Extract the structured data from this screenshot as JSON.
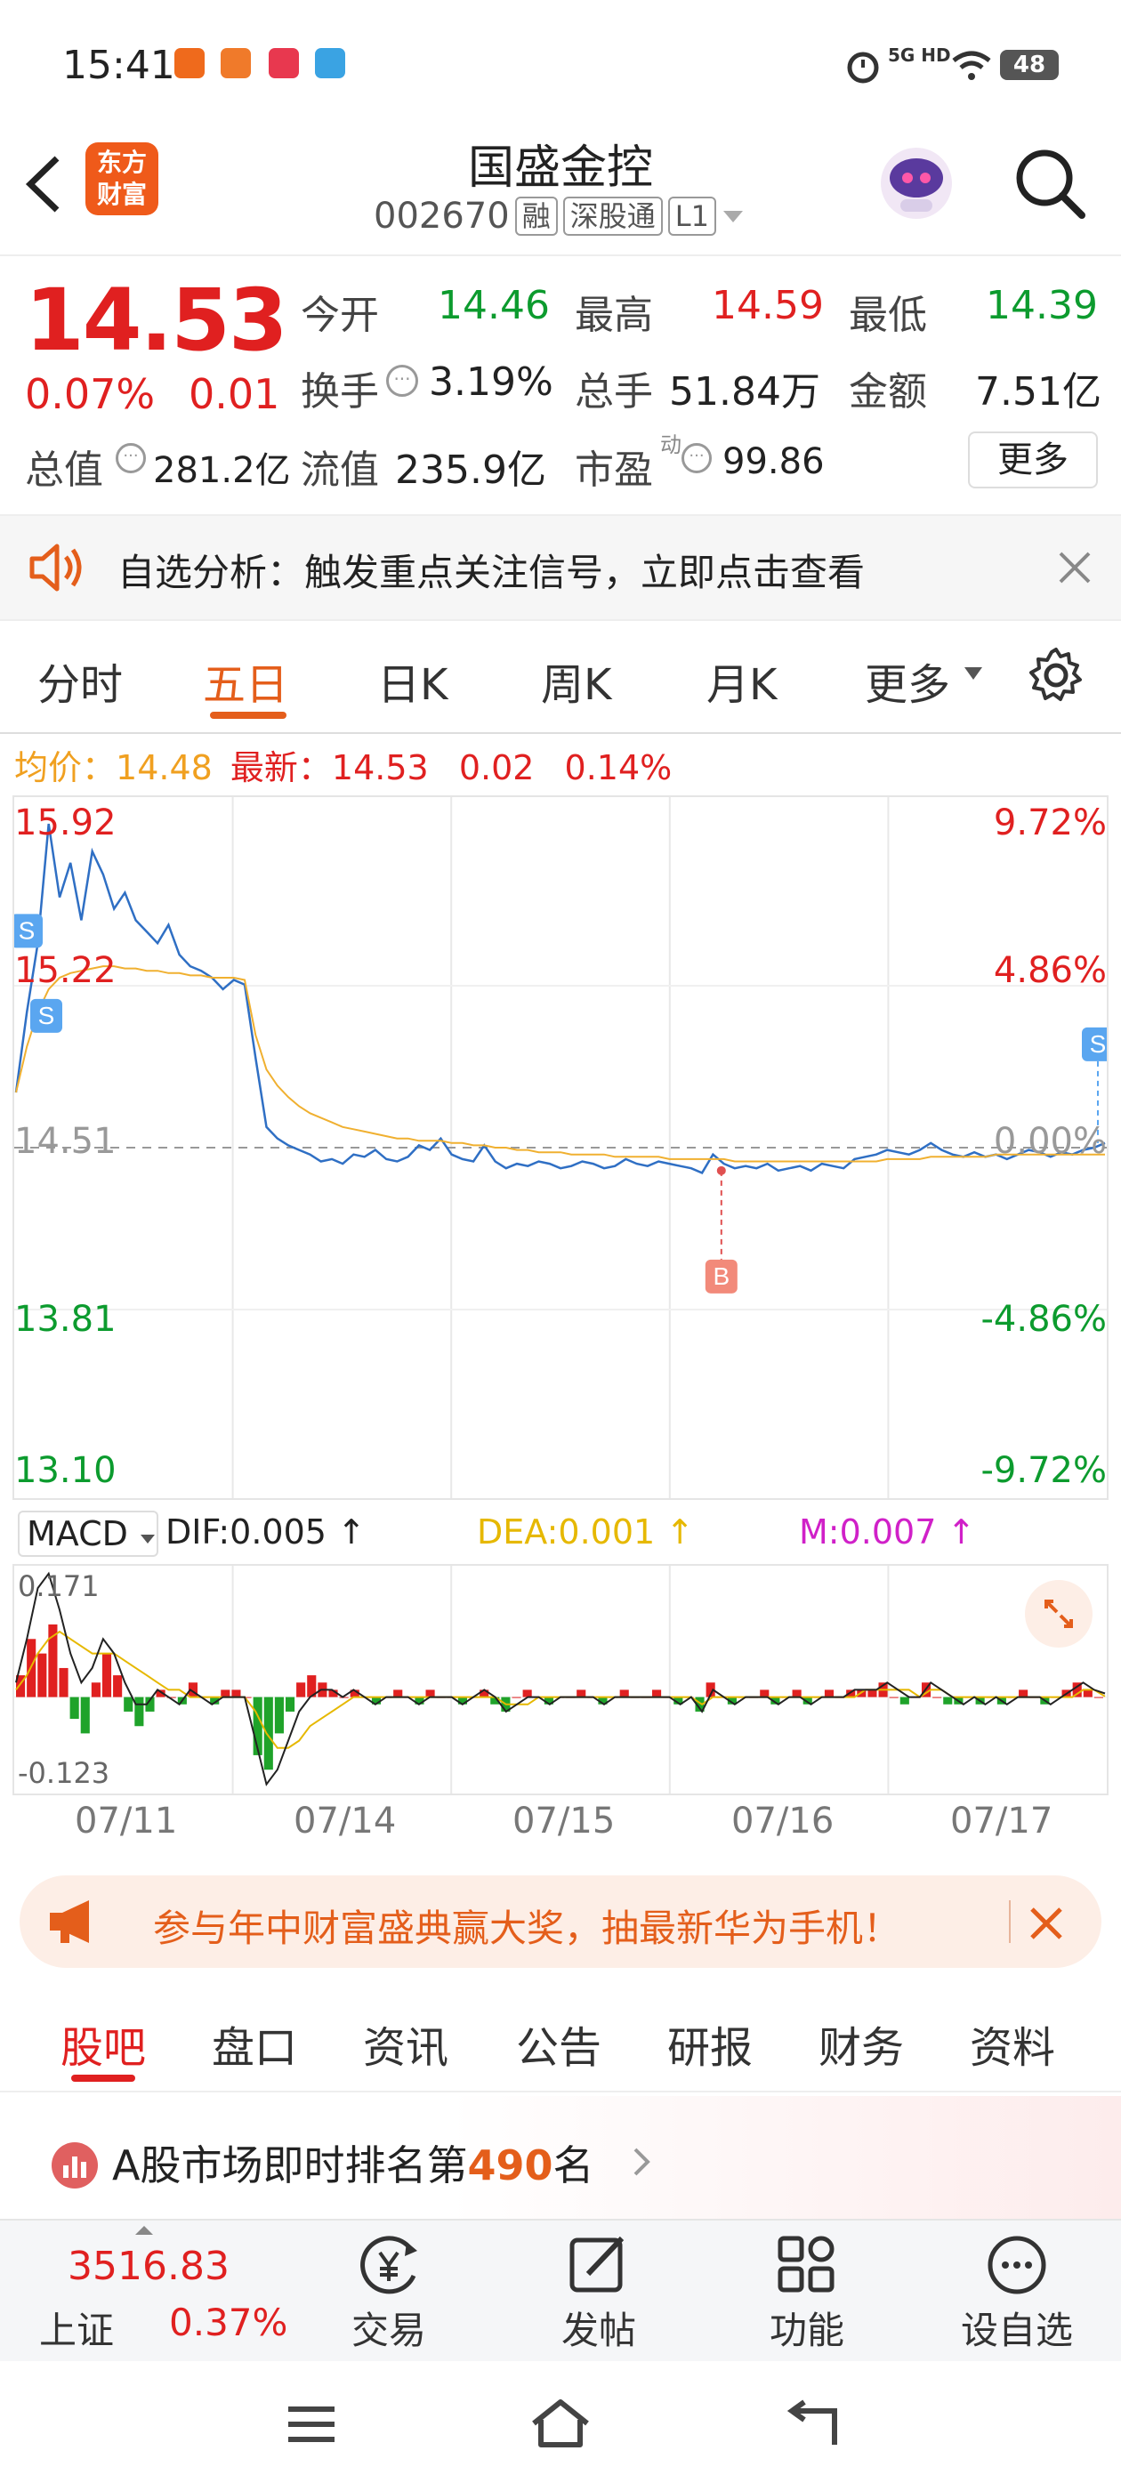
{
  "status_bar": {
    "time": "15:41",
    "network": "5G HD",
    "battery": "48"
  },
  "header": {
    "back_icon": "chevron-left-icon",
    "logo_line1": "东方",
    "logo_line2": "财富",
    "stock_name": "国盛金控",
    "stock_code": "002670",
    "tags": [
      "融",
      "深股通",
      "L1"
    ],
    "search_icon": "search-icon"
  },
  "quote": {
    "price": "14.53",
    "change_pct": "0.07%",
    "change_abs": "0.01",
    "open_label": "今开",
    "open": "14.46",
    "high_label": "最高",
    "high": "14.59",
    "low_label": "最低",
    "low": "14.39",
    "turnover_label": "换手",
    "turnover": "3.19%",
    "volume_label": "总手",
    "volume": "51.84万",
    "amount_label": "金额",
    "amount": "7.51亿",
    "mktcap_label": "总值",
    "mktcap": "281.2亿",
    "float_label": "流值",
    "float_cap": "235.9亿",
    "pe_label": "市盈",
    "pe_sup": "动",
    "pe": "99.86",
    "more_label": "更多"
  },
  "alert": {
    "text": "自选分析：触发重点关注信号，立即点击查看"
  },
  "chart_tabs": [
    "分时",
    "五日",
    "日K",
    "周K",
    "月K",
    "更多"
  ],
  "active_tab": "五日",
  "legend": {
    "avg_label": "均价：",
    "avg": "14.48",
    "latest_label": "最新：",
    "latest": "14.53",
    "change": "0.02",
    "change_pct": "0.14%"
  },
  "chart_data": {
    "type": "line",
    "title": "",
    "y_left_labels": [
      "15.92",
      "15.22",
      "14.51",
      "13.81",
      "13.10"
    ],
    "y_right_labels": [
      "9.72%",
      "4.86%",
      "0.00%",
      "-4.86%",
      "-9.72%"
    ],
    "ylim": [
      13.1,
      15.92
    ],
    "reference": 14.51,
    "x_labels": [
      "07/11",
      "07/14",
      "07/15",
      "07/16",
      "07/17"
    ],
    "markers": [
      {
        "label": "S",
        "day": "07/11",
        "price": 15.45
      },
      {
        "label": "S",
        "day": "07/11",
        "price": 15.08
      },
      {
        "label": "B",
        "day": "07/16",
        "price": 14.41
      },
      {
        "label": "S",
        "day": "07/17",
        "price": 14.53
      }
    ],
    "series": [
      {
        "values": [
          14.75,
          15.1,
          15.4,
          15.92,
          15.6,
          15.75,
          15.5,
          15.8,
          15.7,
          15.55,
          15.62,
          15.5,
          15.45,
          15.4,
          15.48,
          15.35,
          15.3,
          15.28,
          15.25,
          15.2,
          15.24,
          15.22,
          14.9,
          14.6,
          14.55,
          14.52,
          14.5,
          14.48,
          14.45,
          14.46,
          14.44,
          14.48,
          14.47,
          14.5,
          14.46,
          14.45,
          14.47,
          14.52,
          14.5,
          14.55,
          14.48,
          14.46,
          14.45,
          14.52,
          14.45,
          14.42,
          14.44,
          14.43,
          14.45,
          14.44,
          14.42,
          14.43,
          14.45,
          14.44,
          14.42,
          14.43,
          14.46,
          14.44,
          14.43,
          14.45,
          14.44,
          14.43,
          14.42,
          14.4,
          14.48,
          14.44,
          14.42,
          14.43,
          14.42,
          14.44,
          14.41,
          14.42,
          14.43,
          14.41,
          14.44,
          14.43,
          14.42,
          14.46,
          14.47,
          14.48,
          14.5,
          14.49,
          14.48,
          14.5,
          14.53,
          14.5,
          14.48,
          14.47,
          14.49,
          14.47,
          14.48,
          14.46,
          14.48,
          14.5,
          14.49,
          14.47,
          14.49,
          14.48,
          14.5,
          14.51,
          14.53
        ]
      },
      {
        "values": [
          14.75,
          14.95,
          15.1,
          15.2,
          15.25,
          15.27,
          15.28,
          15.29,
          15.3,
          15.3,
          15.29,
          15.29,
          15.28,
          15.28,
          15.27,
          15.27,
          15.26,
          15.26,
          15.25,
          15.25,
          15.25,
          15.24,
          15.0,
          14.85,
          14.78,
          14.73,
          14.69,
          14.66,
          14.64,
          14.62,
          14.6,
          14.59,
          14.58,
          14.57,
          14.56,
          14.55,
          14.55,
          14.54,
          14.54,
          14.54,
          14.53,
          14.53,
          14.52,
          14.52,
          14.51,
          14.51,
          14.5,
          14.5,
          14.49,
          14.49,
          14.49,
          14.48,
          14.48,
          14.48,
          14.48,
          14.47,
          14.47,
          14.47,
          14.47,
          14.47,
          14.46,
          14.46,
          14.46,
          14.46,
          14.46,
          14.46,
          14.45,
          14.45,
          14.45,
          14.45,
          14.45,
          14.45,
          14.45,
          14.45,
          14.45,
          14.45,
          14.45,
          14.45,
          14.45,
          14.45,
          14.46,
          14.46,
          14.46,
          14.46,
          14.47,
          14.47,
          14.47,
          14.47,
          14.47,
          14.47,
          14.48,
          14.48,
          14.48,
          14.48,
          14.48,
          14.48,
          14.48,
          14.48,
          14.48,
          14.48,
          14.48
        ]
      }
    ]
  },
  "macd": {
    "label": "MACD",
    "dif": "DIF:0.005",
    "dea": "DEA:0.001",
    "m": "M:0.007",
    "max": "0.171",
    "min": "-0.123",
    "bars": [
      0.03,
      0.08,
      0.06,
      0.1,
      0.04,
      -0.03,
      -0.05,
      0.02,
      0.06,
      0.03,
      -0.02,
      -0.04,
      -0.02,
      0.01,
      0.0,
      -0.01,
      0.02,
      0.0,
      -0.01,
      0.01,
      0.01,
      0.0,
      -0.08,
      -0.1,
      -0.05,
      -0.02,
      0.02,
      0.03,
      0.02,
      0.01,
      0.0,
      0.01,
      0.0,
      -0.01,
      0.0,
      0.01,
      0.0,
      -0.01,
      0.01,
      0.0,
      0.0,
      -0.01,
      0.0,
      0.01,
      -0.01,
      -0.02,
      0.0,
      0.01,
      0.0,
      -0.01,
      0.0,
      0.0,
      0.01,
      0.0,
      -0.01,
      0.0,
      0.01,
      0.0,
      0.0,
      0.01,
      0.0,
      -0.01,
      0.0,
      -0.02,
      0.02,
      0.0,
      -0.01,
      0.0,
      0.0,
      0.01,
      -0.01,
      0.0,
      0.01,
      -0.01,
      0.0,
      0.01,
      0.0,
      0.01,
      0.01,
      0.01,
      0.02,
      0.0,
      -0.01,
      0.0,
      0.02,
      0.0,
      -0.01,
      -0.01,
      0.0,
      -0.01,
      0.0,
      -0.01,
      0.0,
      0.01,
      0.0,
      -0.01,
      0.0,
      0.01,
      0.02,
      0.01,
      0.0
    ],
    "dif_line": [
      0.02,
      0.08,
      0.15,
      0.17,
      0.12,
      0.06,
      0.02,
      0.04,
      0.08,
      0.06,
      0.02,
      -0.01,
      -0.01,
      0.01,
      0.0,
      -0.01,
      0.01,
      0.0,
      -0.01,
      0.0,
      0.0,
      0.0,
      -0.06,
      -0.12,
      -0.1,
      -0.06,
      -0.02,
      0.0,
      0.01,
      0.01,
      0.0,
      0.01,
      0.0,
      -0.01,
      0.0,
      0.0,
      0.0,
      -0.01,
      0.0,
      0.0,
      0.0,
      -0.01,
      0.0,
      0.01,
      0.0,
      -0.02,
      -0.01,
      0.0,
      0.0,
      -0.01,
      0.0,
      0.0,
      0.0,
      0.0,
      -0.01,
      0.0,
      0.0,
      0.0,
      0.0,
      0.0,
      0.0,
      -0.01,
      0.0,
      -0.02,
      0.01,
      0.0,
      -0.01,
      0.0,
      0.0,
      0.0,
      -0.01,
      0.0,
      0.0,
      -0.01,
      0.0,
      0.0,
      0.0,
      0.01,
      0.01,
      0.01,
      0.02,
      0.01,
      0.0,
      0.0,
      0.02,
      0.01,
      0.0,
      -0.01,
      0.0,
      -0.01,
      0.0,
      -0.01,
      0.0,
      0.0,
      0.0,
      -0.01,
      0.0,
      0.01,
      0.02,
      0.01,
      0.005
    ],
    "dea_line": [
      0.01,
      0.03,
      0.06,
      0.08,
      0.09,
      0.08,
      0.07,
      0.06,
      0.06,
      0.06,
      0.05,
      0.04,
      0.03,
      0.02,
      0.01,
      0.01,
      0.0,
      0.0,
      0.0,
      0.0,
      0.0,
      0.0,
      -0.02,
      -0.05,
      -0.07,
      -0.07,
      -0.06,
      -0.04,
      -0.03,
      -0.02,
      -0.01,
      0.0,
      0.0,
      0.0,
      0.0,
      0.0,
      0.0,
      0.0,
      0.0,
      0.0,
      0.0,
      0.0,
      0.0,
      0.0,
      0.0,
      -0.01,
      -0.01,
      -0.01,
      0.0,
      0.0,
      0.0,
      0.0,
      0.0,
      0.0,
      0.0,
      0.0,
      0.0,
      0.0,
      0.0,
      0.0,
      0.0,
      0.0,
      0.0,
      -0.01,
      0.0,
      0.0,
      0.0,
      0.0,
      0.0,
      0.0,
      0.0,
      0.0,
      0.0,
      0.0,
      0.0,
      0.0,
      0.0,
      0.0,
      0.01,
      0.01,
      0.01,
      0.01,
      0.01,
      0.0,
      0.01,
      0.01,
      0.0,
      0.0,
      0.0,
      0.0,
      0.0,
      0.0,
      0.0,
      0.0,
      0.0,
      0.0,
      0.0,
      0.0,
      0.01,
      0.01,
      0.001
    ]
  },
  "banner": {
    "text": "参与年中财富盛典赢大奖，抽最新华为手机！"
  },
  "sub_tabs": [
    "股吧",
    "盘口",
    "资讯",
    "公告",
    "研报",
    "财务",
    "资料"
  ],
  "active_sub_tab": "股吧",
  "ranking": {
    "prefix": "A股市场即时排名第",
    "rank": "490",
    "suffix": "名"
  },
  "bottom_nav": {
    "index_value": "3516.83",
    "index_name": "上证",
    "index_change": "0.37%",
    "items": [
      {
        "label": "交易",
        "icon": "trade-yen-icon"
      },
      {
        "label": "发帖",
        "icon": "edit-post-icon"
      },
      {
        "label": "功能",
        "icon": "grid-apps-icon"
      },
      {
        "label": "设自选",
        "icon": "more-dots-icon"
      }
    ]
  },
  "colors": {
    "accent": "#e45e1b",
    "up": "#e02020",
    "down": "#0c9b2e",
    "price_line": "#2f6fc4",
    "avg_line": "#f0b030"
  }
}
